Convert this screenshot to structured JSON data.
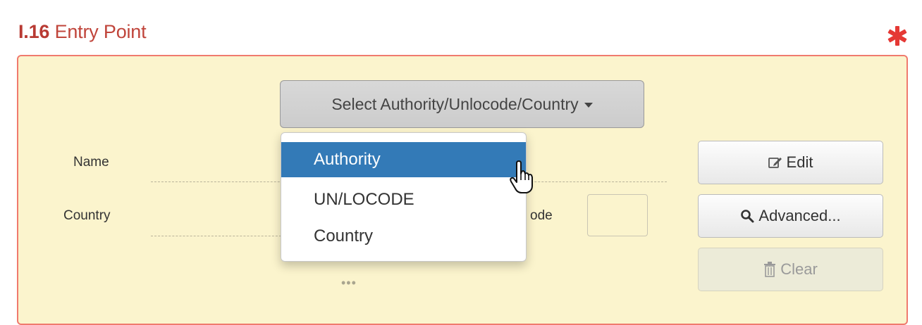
{
  "section": {
    "number": "I.16",
    "label": "Entry Point",
    "required_marker": "asterisk-icon"
  },
  "select_button": {
    "label": "Select Authority/Unlocode/Country"
  },
  "fields": {
    "name_label": "Name",
    "country_label": "Country",
    "code_label_visible": "ode",
    "more_dots": "•••"
  },
  "buttons": {
    "edit": "Edit",
    "advanced": "Advanced...",
    "clear": "Clear"
  },
  "dropdown": {
    "items": [
      {
        "label": "Authority",
        "active": true
      },
      {
        "label": "UN/LOCODE",
        "active": false
      },
      {
        "label": "Country",
        "active": false
      }
    ]
  },
  "colors": {
    "title_red": "#c0392b",
    "panel_bg": "#fbf4cd",
    "panel_border": "#f07a6e",
    "active_item": "#337ab7"
  }
}
